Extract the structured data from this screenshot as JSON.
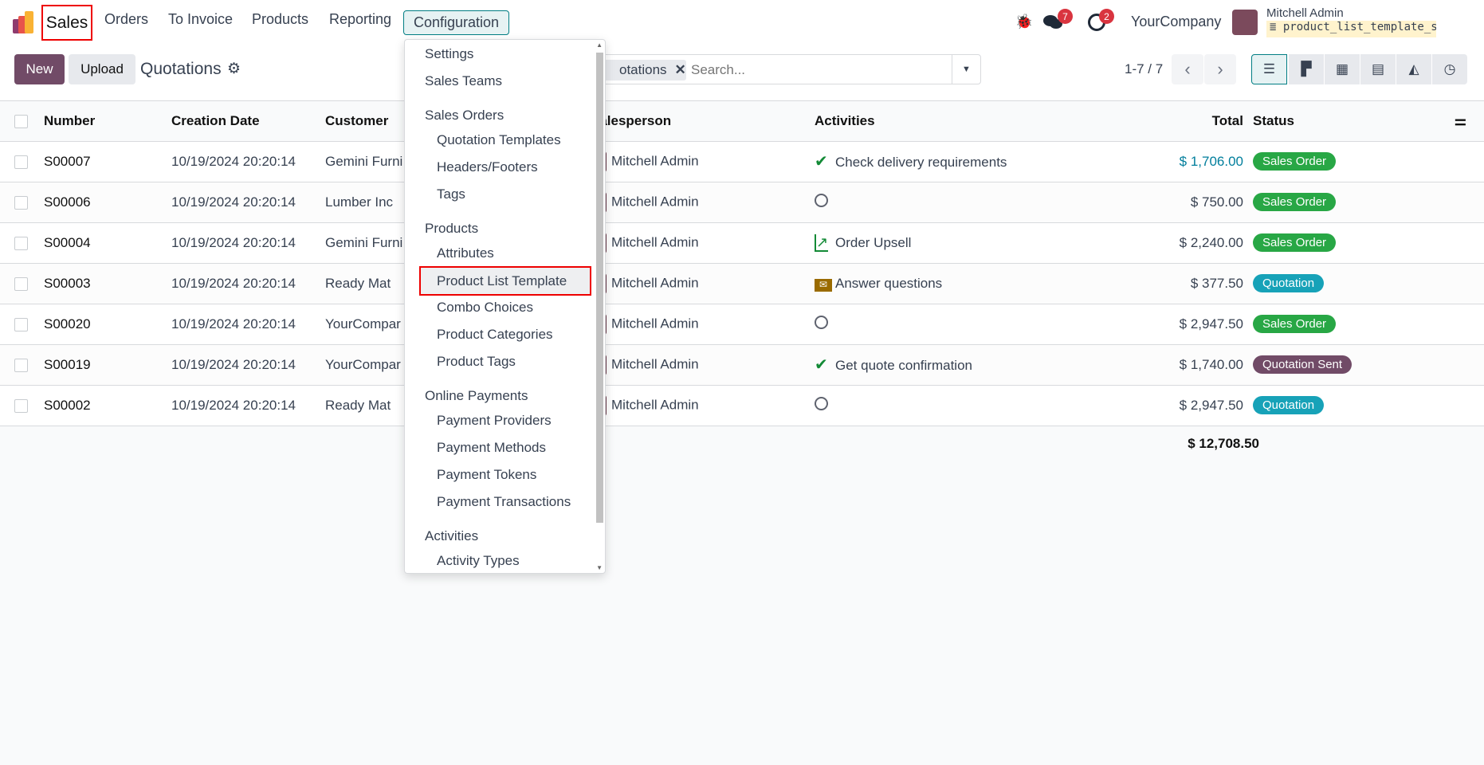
{
  "nav": {
    "brand": "Sales",
    "items": [
      "Orders",
      "To Invoice",
      "Products",
      "Reporting",
      "Configuration"
    ],
    "messages_count": "7",
    "activities_count": "2",
    "company": "YourCompany",
    "user": "Mitchell Admin",
    "database": "product_list_template_sa…"
  },
  "control": {
    "new": "New",
    "upload": "Upload",
    "title": "Quotations",
    "facet": "otations",
    "search_placeholder": "Search...",
    "pager": "1-7 / 7"
  },
  "views": [
    "list-icon",
    "kanban-icon",
    "calendar-icon",
    "pivot-icon",
    "graph-icon",
    "activity-icon"
  ],
  "table": {
    "headers": [
      "Number",
      "Creation Date",
      "Customer",
      "Salesperson",
      "Activities",
      "Total",
      "Status"
    ],
    "rows": [
      {
        "number": "S00007",
        "date": "10/19/2024 20:20:14",
        "customer": "Gemini Furni",
        "salesperson": "Mitchell Admin",
        "activity_icon": "check-icon",
        "activity": "Check delivery requirements",
        "total": "$ 1,706.00",
        "status": "Sales Order"
      },
      {
        "number": "S00006",
        "date": "10/19/2024 20:20:14",
        "customer": "Lumber Inc",
        "salesperson": "Mitchell Admin",
        "activity_icon": "clock-icon",
        "activity": "",
        "total": "$ 750.00",
        "status": "Sales Order"
      },
      {
        "number": "S00004",
        "date": "10/19/2024 20:20:14",
        "customer": "Gemini Furni",
        "salesperson": "Mitchell Admin",
        "activity_icon": "chart-up-icon",
        "activity": "Order Upsell",
        "total": "$ 2,240.00",
        "status": "Sales Order"
      },
      {
        "number": "S00003",
        "date": "10/19/2024 20:20:14",
        "customer": "Ready Mat",
        "salesperson": "Mitchell Admin",
        "activity_icon": "envelope-icon",
        "activity": "Answer questions",
        "total": "$ 377.50",
        "status": "Quotation"
      },
      {
        "number": "S00020",
        "date": "10/19/2024 20:20:14",
        "customer": "YourCompar",
        "salesperson": "Mitchell Admin",
        "activity_icon": "clock-icon",
        "activity": "",
        "total": "$ 2,947.50",
        "status": "Sales Order"
      },
      {
        "number": "S00019",
        "date": "10/19/2024 20:20:14",
        "customer": "YourCompar",
        "salesperson": "Mitchell Admin",
        "activity_icon": "check-icon",
        "activity": "Get quote confirmation",
        "total": "$ 1,740.00",
        "status": "Quotation Sent"
      },
      {
        "number": "S00002",
        "date": "10/19/2024 20:20:14",
        "customer": "Ready Mat",
        "salesperson": "Mitchell Admin",
        "activity_icon": "clock-icon",
        "activity": "",
        "total": "$ 2,947.50",
        "status": "Quotation"
      }
    ],
    "sum": "$ 12,708.50"
  },
  "status_colors": {
    "Sales Order": "#28a745",
    "Quotation": "#17a2b8",
    "Quotation Sent": "#714b67"
  },
  "menu": {
    "items": [
      {
        "type": "item",
        "label": "Settings"
      },
      {
        "type": "item",
        "label": "Sales Teams"
      },
      {
        "type": "header",
        "label": "Sales Orders"
      },
      {
        "type": "sub",
        "label": "Quotation Templates"
      },
      {
        "type": "sub",
        "label": "Headers/Footers"
      },
      {
        "type": "sub",
        "label": "Tags"
      },
      {
        "type": "header",
        "label": "Products"
      },
      {
        "type": "sub",
        "label": "Attributes"
      },
      {
        "type": "sub",
        "label": "Product List Template",
        "highlighted": true
      },
      {
        "type": "sub",
        "label": "Combo Choices"
      },
      {
        "type": "sub",
        "label": "Product Categories"
      },
      {
        "type": "sub",
        "label": "Product Tags"
      },
      {
        "type": "header",
        "label": "Online Payments"
      },
      {
        "type": "sub",
        "label": "Payment Providers"
      },
      {
        "type": "sub",
        "label": "Payment Methods"
      },
      {
        "type": "sub",
        "label": "Payment Tokens"
      },
      {
        "type": "sub",
        "label": "Payment Transactions"
      },
      {
        "type": "header",
        "label": "Activities"
      },
      {
        "type": "sub",
        "label": "Activity Types"
      }
    ]
  }
}
